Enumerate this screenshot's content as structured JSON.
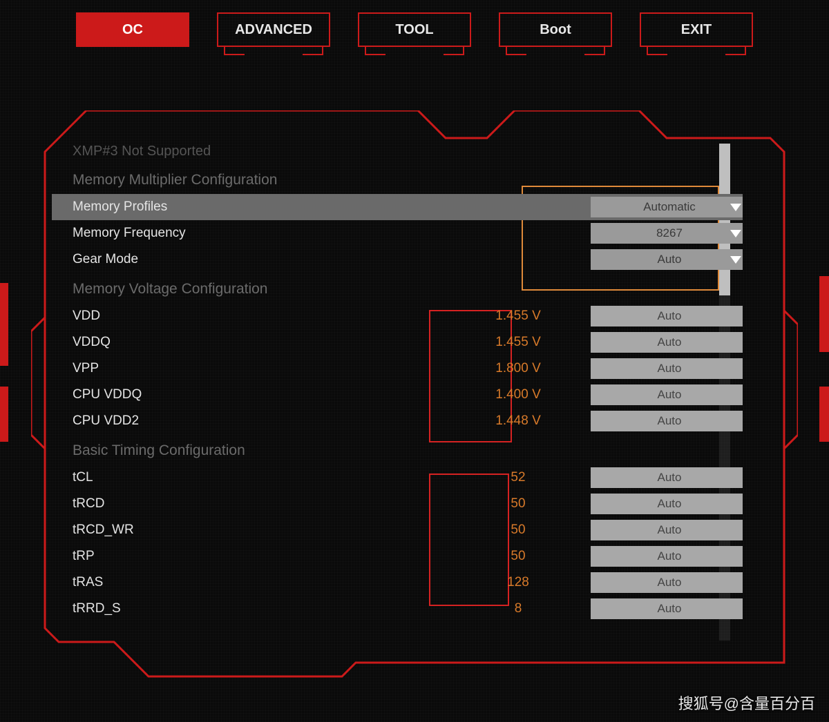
{
  "tabs": {
    "oc": "OC",
    "advanced": "ADVANCED",
    "tool": "TOOL",
    "boot": "Boot",
    "exit": "EXIT",
    "active": "oc"
  },
  "headers": {
    "xmp3": "XMP#3 Not Supported",
    "mem_mult": "Memory Multiplier Configuration",
    "mem_volt": "Memory Voltage Configuration",
    "basic_timing": "Basic Timing Configuration"
  },
  "mem_mult": {
    "profiles": {
      "label": "Memory Profiles",
      "value": "Automatic"
    },
    "frequency": {
      "label": "Memory Frequency",
      "value": "8267"
    },
    "gear_mode": {
      "label": "Gear Mode",
      "value": "Auto"
    }
  },
  "voltage": {
    "vdd": {
      "label": "VDD",
      "reading": "1.455 V",
      "field": "Auto"
    },
    "vddq": {
      "label": "VDDQ",
      "reading": "1.455 V",
      "field": "Auto"
    },
    "vpp": {
      "label": "VPP",
      "reading": "1.800 V",
      "field": "Auto"
    },
    "cpu_vddq": {
      "label": "CPU VDDQ",
      "reading": "1.400 V",
      "field": "Auto"
    },
    "cpu_vdd2": {
      "label": "CPU VDD2",
      "reading": "1.448 V",
      "field": "Auto"
    }
  },
  "timing": {
    "tcl": {
      "label": "tCL",
      "reading": "52",
      "field": "Auto"
    },
    "trcd": {
      "label": "tRCD",
      "reading": "50",
      "field": "Auto"
    },
    "trcd_wr": {
      "label": "tRCD_WR",
      "reading": "50",
      "field": "Auto"
    },
    "trp": {
      "label": "tRP",
      "reading": "50",
      "field": "Auto"
    },
    "tras": {
      "label": "tRAS",
      "reading": "128",
      "field": "Auto"
    },
    "trrd_s": {
      "label": "tRRD_S",
      "reading": "8",
      "field": "Auto"
    }
  },
  "watermark": "搜狐号@含量百分百"
}
